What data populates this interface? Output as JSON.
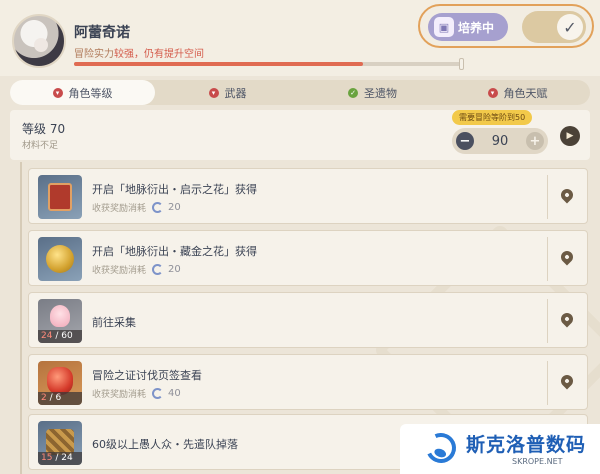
{
  "character": {
    "name": "阿蕾奇诺",
    "power_prefix": "冒险实力",
    "power_status": "较强，仍有提升空间",
    "progress_fraction": 0.74
  },
  "train_toggle": {
    "label": "培养中",
    "enabled": true,
    "check_glyph": "✓"
  },
  "tabs": [
    {
      "label": "角色等级",
      "active": true,
      "dot_color": "#c84b4b"
    },
    {
      "label": "武器",
      "active": false,
      "dot_color": "#c84b4b"
    },
    {
      "label": "圣遗物",
      "active": false,
      "dot_color": "#6aa33f"
    },
    {
      "label": "角色天赋",
      "active": false,
      "dot_color": "#c84b4b"
    }
  ],
  "level": {
    "title": "等级 70",
    "subtitle": "材料不足",
    "requirement": "需要冒险等阶到50",
    "target_value": "90",
    "minus": "−",
    "plus": "+"
  },
  "tasks": [
    {
      "title": "开启「地脉衍出・启示之花」获得",
      "sub": "收获奖励消耗",
      "cost": "20",
      "count": "",
      "have": ""
    },
    {
      "title": "开启「地脉衍出・藏金之花」获得",
      "sub": "收获奖励消耗",
      "cost": "20",
      "count": "",
      "have": ""
    },
    {
      "title": "前往采集",
      "sub": "",
      "cost": "",
      "have": "24",
      "count": "/ 60"
    },
    {
      "title": "冒险之证讨伐页签查看",
      "sub": "收获奖励消耗",
      "cost": "40",
      "have": "2",
      "count": "/ 6"
    },
    {
      "title": "60级以上愚人众・先遣队掉落",
      "sub": "",
      "cost": "",
      "have": "15",
      "count": "/ 24"
    }
  ],
  "watermark": {
    "brand": "斯克洛普数码",
    "url": "SKROPE.NET"
  }
}
